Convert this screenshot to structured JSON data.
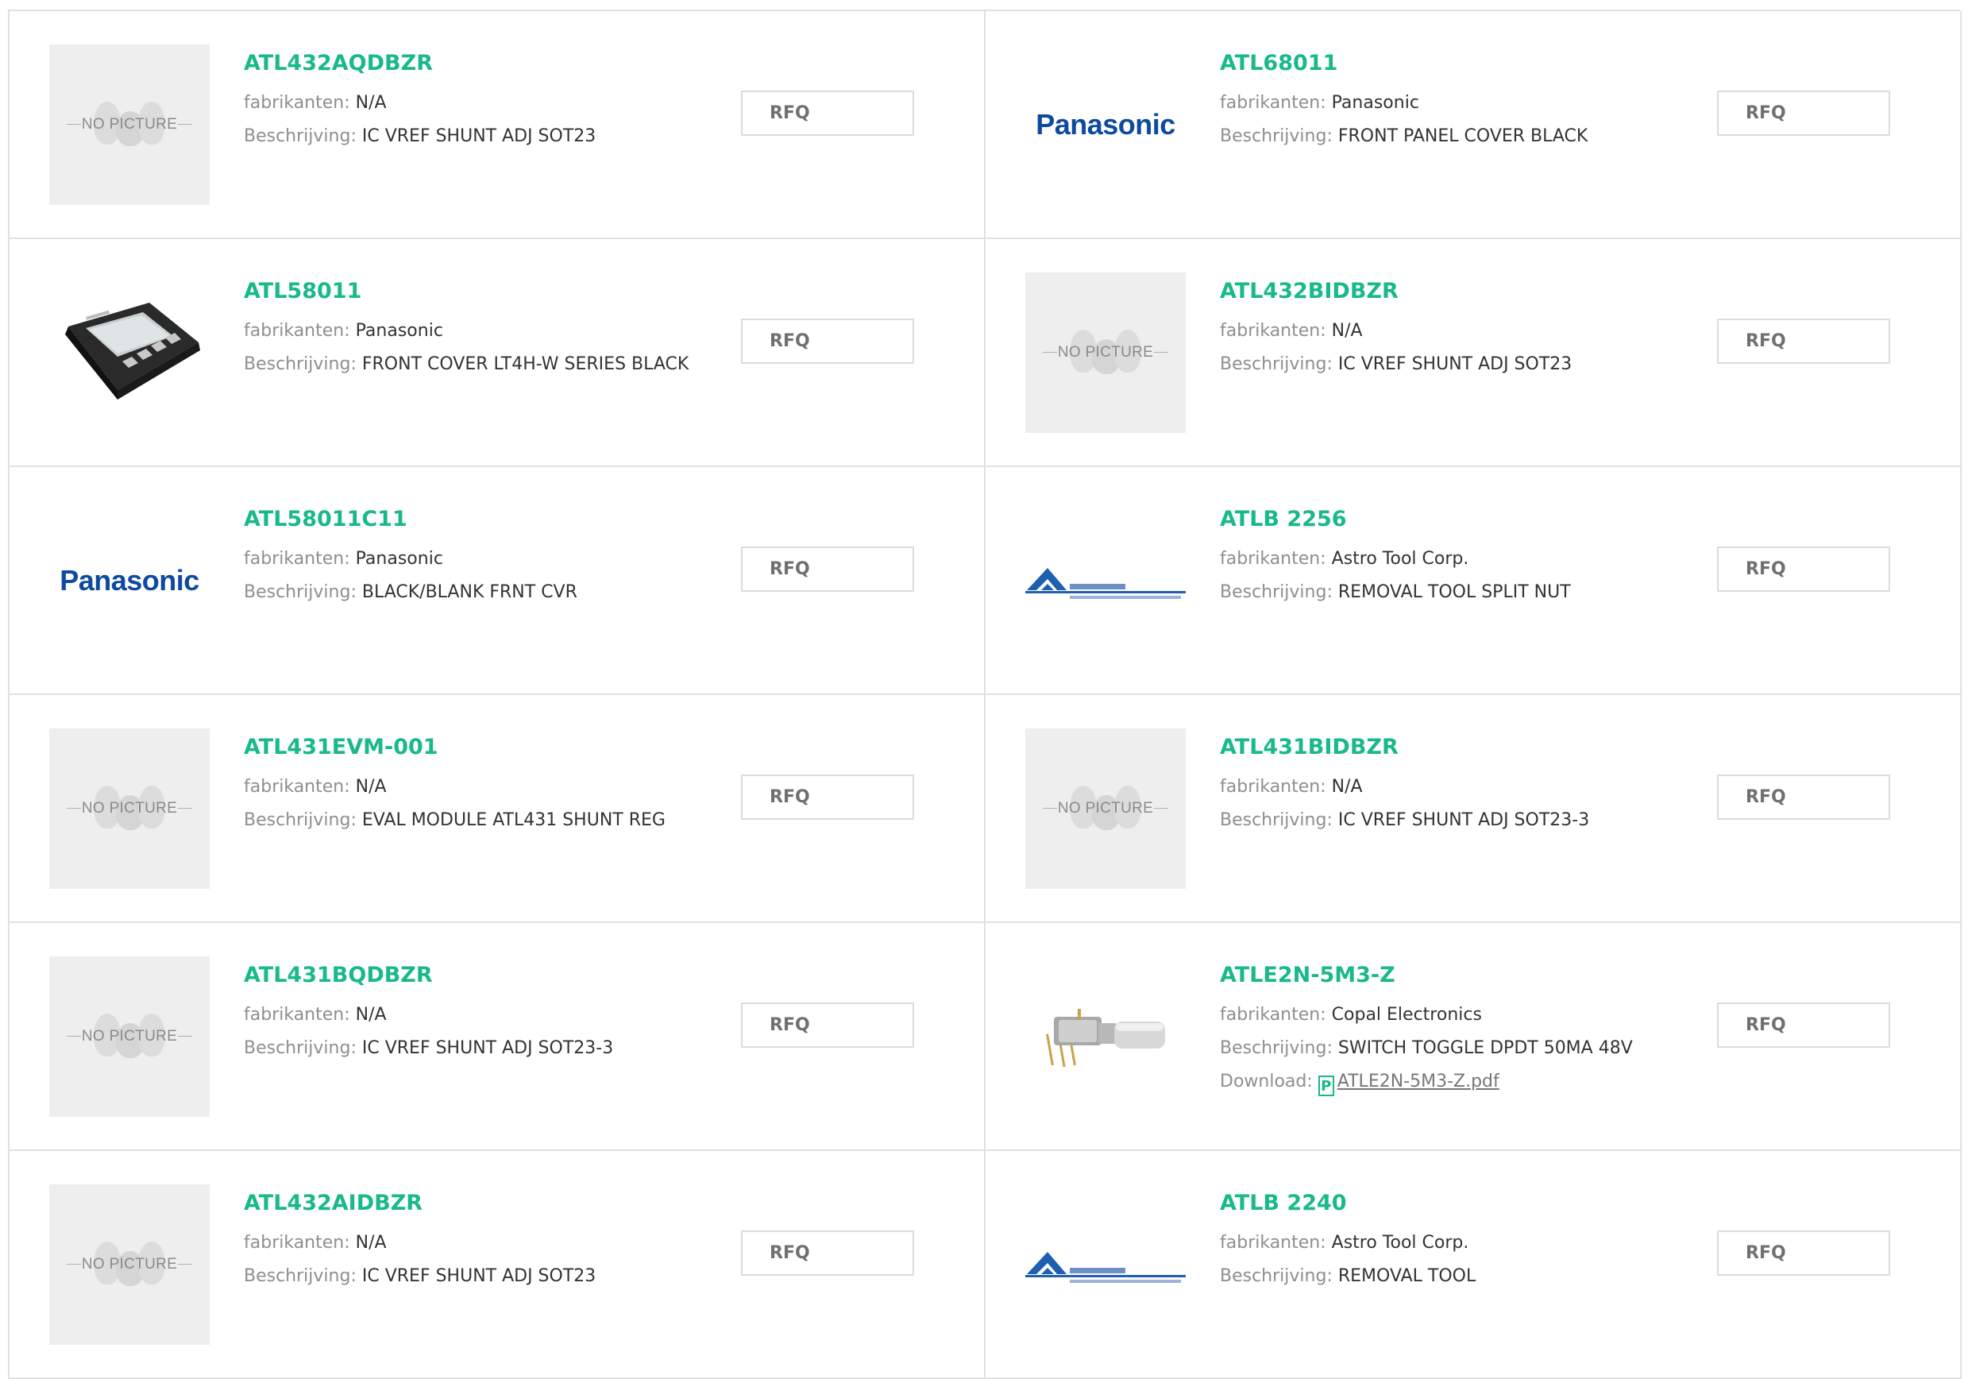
{
  "labels": {
    "manufacturer": "fabrikanten:",
    "description": "Beschrijving:",
    "download": "Download:",
    "no_picture": "NO PICTURE",
    "rfq": "RFQ"
  },
  "colors": {
    "part_link": "#19b98a",
    "border": "#e1e1e1",
    "panasonic_blue": "#0d4aa0"
  },
  "products": [
    {
      "part": "ATL432AQDBZR",
      "manufacturer": "N/A",
      "description": "IC VREF SHUNT ADJ SOT23",
      "image": "no-picture"
    },
    {
      "part": "ATL68011",
      "manufacturer": "Panasonic",
      "description": "FRONT PANEL COVER BLACK",
      "image": "panasonic-logo",
      "logo_text": "Panasonic"
    },
    {
      "part": "ATL58011",
      "manufacturer": "Panasonic",
      "description": "FRONT COVER LT4H-W SERIES BLACK",
      "image": "device-photo"
    },
    {
      "part": "ATL432BIDBZR",
      "manufacturer": "N/A",
      "description": "IC VREF SHUNT ADJ SOT23",
      "image": "no-picture"
    },
    {
      "part": "ATL58011C11",
      "manufacturer": "Panasonic",
      "description": "BLACK/BLANK FRNT CVR",
      "image": "panasonic-logo",
      "logo_text": "Panasonic"
    },
    {
      "part": "ATLB 2256",
      "manufacturer": "Astro Tool Corp.",
      "description": "REMOVAL TOOL SPLIT NUT",
      "image": "astro-logo"
    },
    {
      "part": "ATL431EVM-001",
      "manufacturer": "N/A",
      "description": "EVAL MODULE ATL431 SHUNT REG",
      "image": "no-picture"
    },
    {
      "part": "ATL431BIDBZR",
      "manufacturer": "N/A",
      "description": "IC VREF SHUNT ADJ SOT23-3",
      "image": "no-picture"
    },
    {
      "part": "ATL431BQDBZR",
      "manufacturer": "N/A",
      "description": "IC VREF SHUNT ADJ SOT23-3",
      "image": "no-picture"
    },
    {
      "part": "ATLE2N-5M3-Z",
      "manufacturer": "Copal Electronics",
      "description": "SWITCH TOGGLE DPDT 50MA 48V",
      "image": "switch-photo",
      "download": "ATLE2N-5M3-Z.pdf"
    },
    {
      "part": "ATL432AIDBZR",
      "manufacturer": "N/A",
      "description": "IC VREF SHUNT ADJ SOT23",
      "image": "no-picture"
    },
    {
      "part": "ATLB 2240",
      "manufacturer": "Astro Tool Corp.",
      "description": "REMOVAL TOOL",
      "image": "astro-logo"
    }
  ]
}
